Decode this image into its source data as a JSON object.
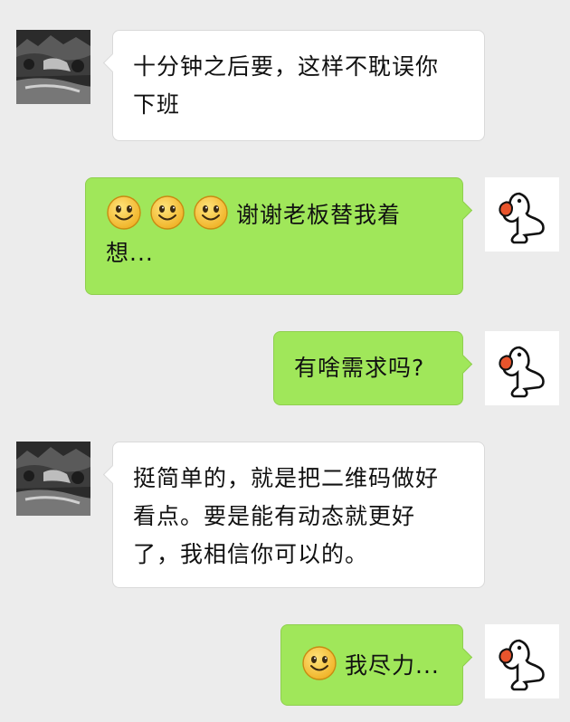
{
  "messages": [
    {
      "sender": "boss",
      "lines": [
        "十分钟之后要，这样不耽误你",
        "下班"
      ]
    },
    {
      "sender": "me",
      "emoji_count": 3,
      "emoji_icon": "smile-emoji-icon",
      "lines": [
        "谢谢老板替我着",
        "想..."
      ]
    },
    {
      "sender": "me",
      "lines": [
        "有啥需求吗?"
      ]
    },
    {
      "sender": "boss",
      "lines": [
        "挺简单的，就是把二维码做好",
        "看点。要是能有动态就更好",
        "了，我相信你可以的。"
      ]
    },
    {
      "sender": "me",
      "emoji_count": 1,
      "emoji_icon": "smile-emoji-icon",
      "lines": [
        "我尽力..."
      ]
    }
  ],
  "avatars": {
    "boss": {
      "icon": "landscape-photo-avatar-icon"
    },
    "me": {
      "icon": "cartoon-duck-avatar-icon"
    }
  },
  "colors": {
    "background": "#ececec",
    "incoming_bubble": "#ffffff",
    "outgoing_bubble": "#a0e75a",
    "duck_beak": "#e8542c",
    "emoji_face": "#f5c542"
  }
}
